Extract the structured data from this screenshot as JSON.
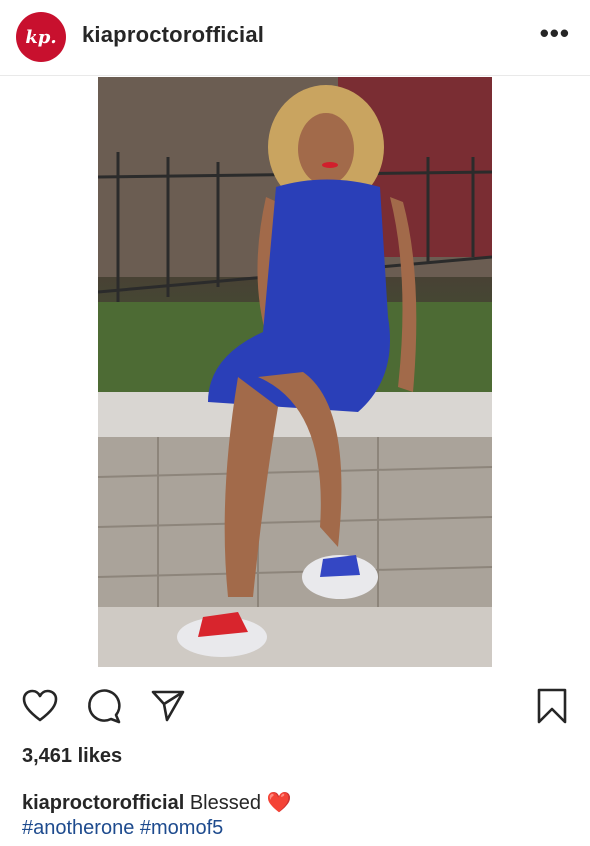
{
  "header": {
    "avatar_text": "kp.",
    "username": "kiaproctorofficial",
    "more_label": "•••"
  },
  "post": {
    "image_icon": "photo"
  },
  "actions": {
    "icons": [
      "heart-icon",
      "comment-icon",
      "share-icon",
      "bookmark-icon"
    ]
  },
  "likes": {
    "text": "3,461 likes"
  },
  "caption": {
    "username": "kiaproctorofficial",
    "text": "Blessed",
    "emoji": "❤️"
  },
  "hashtags": [
    "#anotherone",
    "#momof5"
  ],
  "colors": {
    "avatar_bg": "#c8102e",
    "hashtag": "#1e4b8e"
  }
}
